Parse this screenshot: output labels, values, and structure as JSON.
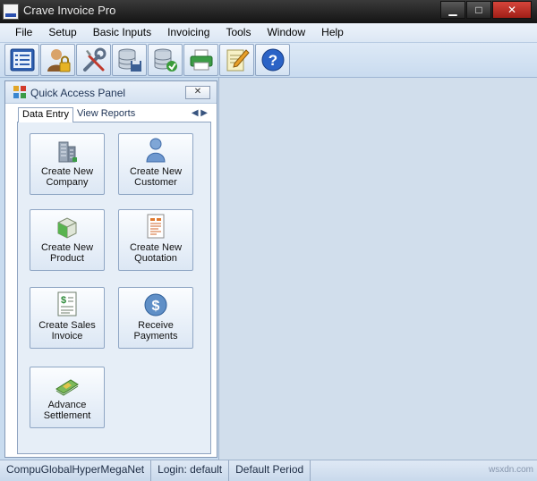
{
  "window": {
    "title": "Crave Invoice Pro"
  },
  "menu": [
    "File",
    "Setup",
    "Basic Inputs",
    "Invoicing",
    "Tools",
    "Window",
    "Help"
  ],
  "toolbar": {
    "icons": [
      "list-view-icon",
      "user-lock-icon",
      "tools-icon",
      "database-save-icon",
      "database-restore-icon",
      "printer-icon",
      "notepad-pencil-icon",
      "help-icon"
    ]
  },
  "panel": {
    "title": "Quick Access Panel",
    "close": "✕",
    "tabs": [
      "Data Entry",
      "View Reports"
    ],
    "tiles": [
      {
        "line1": "Create New",
        "line2": "Company",
        "icon": "building-icon"
      },
      {
        "line1": "Create New",
        "line2": "Customer",
        "icon": "person-icon"
      },
      {
        "line1": "Create New",
        "line2": "Product",
        "icon": "box-icon"
      },
      {
        "line1": "Create New",
        "line2": "Quotation",
        "icon": "quotation-document-icon"
      },
      {
        "line1": "Create Sales",
        "line2": "Invoice",
        "icon": "invoice-dollar-icon"
      },
      {
        "line1": "Receive",
        "line2": "Payments",
        "icon": "dollar-coin-icon"
      },
      {
        "line1": "Advance",
        "line2": "Settlement",
        "icon": "cash-bundle-icon"
      }
    ]
  },
  "status": {
    "company": "CompuGlobalHyperMegaNet",
    "login": "Login: default",
    "period": "Default Period"
  },
  "watermark": "wsxdn.com"
}
